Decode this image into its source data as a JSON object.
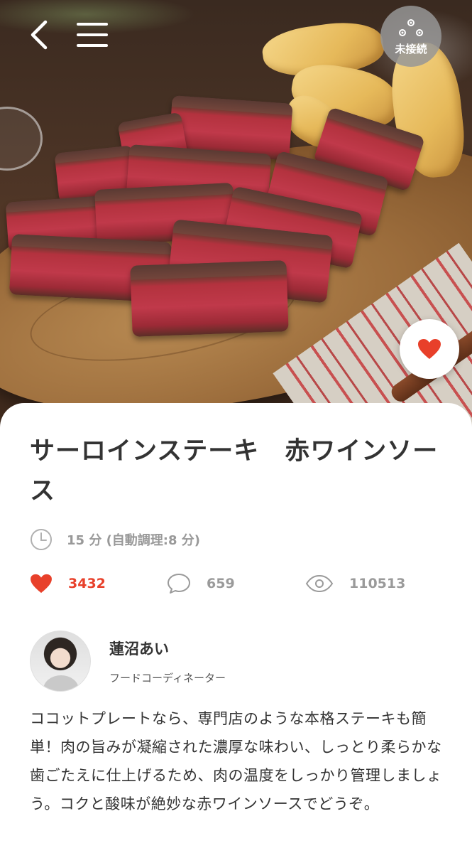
{
  "header": {
    "back_icon": "chevron-left-icon",
    "menu_icon": "hamburger-menu-icon",
    "status": {
      "icon": "gears-icon",
      "label": "未接続"
    }
  },
  "hero": {
    "favorite_icon": "heart-icon"
  },
  "recipe": {
    "title": "サーロインステーキ　赤ワインソース",
    "time_icon": "clock-icon",
    "time_text": "15 分 (自動調理:8 分)",
    "stats": {
      "likes": "3432",
      "comments": "659",
      "views": "110513"
    }
  },
  "author": {
    "name": "蓮沼あい",
    "role": "フードコーディネーター"
  },
  "description": "ココットプレートなら、専門店のような本格ステーキも簡単！肉の旨みが凝縮された濃厚な味わい、しっとり柔らかな歯ごたえに仕上げるため、肉の温度をしっかり管理しましょう。コクと酸味が絶妙な赤ワインソースでどうぞ。",
  "colors": {
    "accent_red": "#e8402a",
    "muted_gray": "#9a9a9a",
    "text": "#333333"
  }
}
